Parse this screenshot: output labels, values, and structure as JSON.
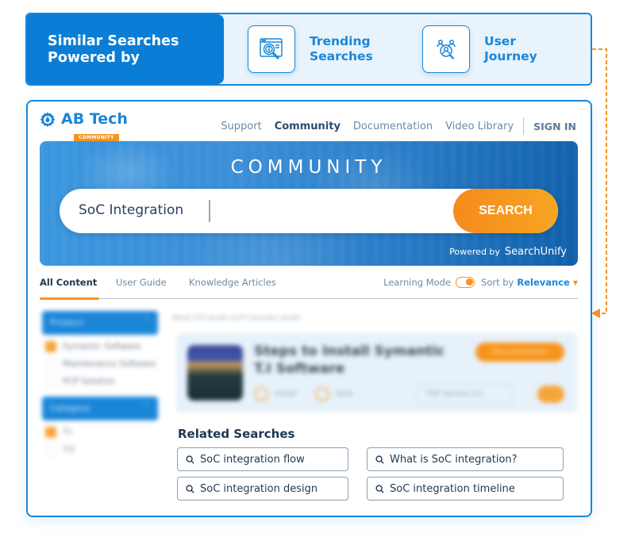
{
  "banner": {
    "title_line1": "Similar Searches",
    "title_line2": "Powered by",
    "features": [
      {
        "icon": "browser-search-info-icon",
        "line1": "Trending",
        "line2": "Searches"
      },
      {
        "icon": "user-group-search-icon",
        "line1": "User",
        "line2": "Journey"
      }
    ]
  },
  "colors": {
    "primary_blue": "#1a86d8",
    "accent_orange": "#f7941d",
    "text_dark": "#1f3852"
  },
  "site": {
    "logo_name": "AB Tech",
    "logo_badge": "COMMUNITY",
    "nav": [
      "Support",
      "Community",
      "Documentation",
      "Video Library"
    ],
    "active_nav": "Community",
    "sign_in": "SIGN IN"
  },
  "hero": {
    "title": "COMMUNITY",
    "search_value": "SoC Integration",
    "search_button": "SEARCH",
    "powered_by": "Powered by",
    "powered_brand": "SearchUnify"
  },
  "tabs": {
    "items": [
      "All Content",
      "User Guide",
      "Knowledge Articles"
    ],
    "active": "All Content",
    "learning_mode_label": "Learning Mode",
    "learning_mode_on": true,
    "sort_label": "Sort by",
    "sort_value": "Relevance"
  },
  "sidebar": {
    "facets": [
      {
        "title": "Product",
        "items": [
          {
            "label": "Symantic Software",
            "checked": true
          },
          {
            "label": "Maintenance Software",
            "checked": false
          },
          {
            "label": "PCP Solution",
            "checked": false
          }
        ]
      },
      {
        "title": "Category",
        "items": [
          {
            "label": "T.I",
            "checked": true
          },
          {
            "label": "T.II",
            "checked": false
          }
        ]
      }
    ]
  },
  "results": {
    "count_text": "About 120 results (0.07 seconds) results",
    "items": [
      {
        "title": "Steps to Install Symantic T.I Software",
        "tag": "Documentation",
        "meta1": "Install",
        "meta2": "Slow",
        "version": "PDF Version 4.1"
      }
    ]
  },
  "related": {
    "title": "Related Searches",
    "items": [
      "SoC integration flow",
      "What is SoC integration?",
      "SoC integration design",
      "SoC integration timeline"
    ]
  }
}
